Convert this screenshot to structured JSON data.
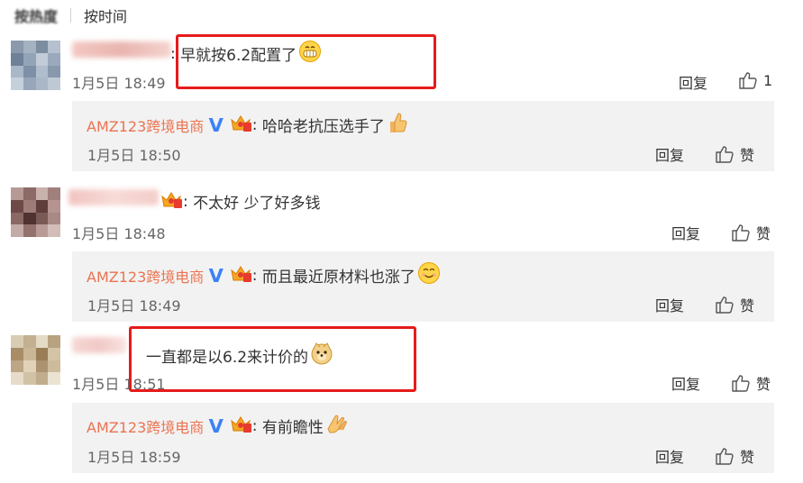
{
  "tabs": {
    "hot": "按热度",
    "time": "按时间"
  },
  "comments": [
    {
      "text": "早就按6.2配置了",
      "time": "1月5日 18:49",
      "reply_label": "回复",
      "like_label": "1",
      "reply": {
        "author": "AMZ123跨境电商",
        "text": "哈哈老抗压选手了",
        "time": "1月5日 18:50",
        "reply_label": "回复",
        "like_label": "赞"
      }
    },
    {
      "text": "不太好 少了好多钱",
      "time": "1月5日 18:48",
      "reply_label": "回复",
      "like_label": "赞",
      "reply": {
        "author": "AMZ123跨境电商",
        "text": "而且最近原材料也涨了",
        "time": "1月5日 18:49",
        "reply_label": "回复",
        "like_label": "赞"
      }
    },
    {
      "text": "一直都是以6.2来计价的",
      "time": "1月5日 18:51",
      "reply_label": "回复",
      "like_label": "赞",
      "reply": {
        "author": "AMZ123跨境电商",
        "text": "有前瞻性",
        "time": "1月5日 18:59",
        "reply_label": "回复",
        "like_label": "赞"
      }
    }
  ],
  "colors": {
    "author": "#eb7350",
    "highlight": "#e61b1b",
    "reply_bg": "#f2f2f2",
    "verified": "#3b82f6"
  },
  "icons": [
    "thumbs-up-icon",
    "verified-v-icon",
    "crown-badge-icon",
    "grin-emoji-icon",
    "thumbs-emoji-icon",
    "hehe-emoji-icon",
    "doge-emoji-icon",
    "clap-emoji-icon"
  ]
}
